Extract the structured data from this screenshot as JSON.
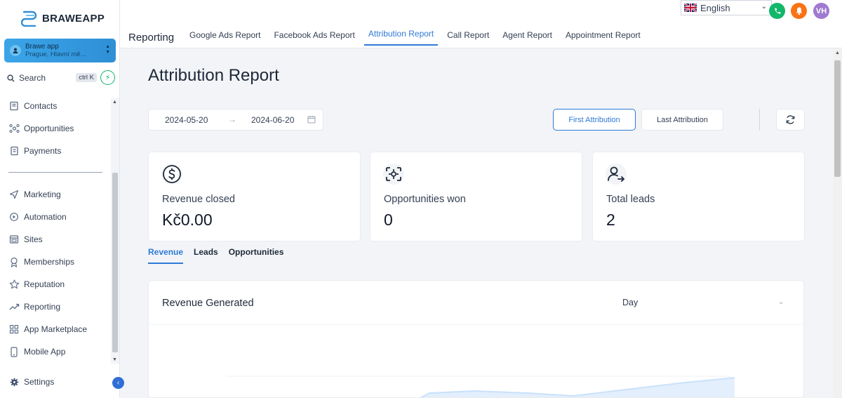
{
  "sidebar": {
    "logo_text": "BRAWEAPP",
    "account": {
      "name": "Brawe app",
      "location": "Prague, Hlavní mě..."
    },
    "search": {
      "label": "Search",
      "shortcut": "ctrl K"
    },
    "items_top": [
      {
        "label": "Contacts",
        "icon": "contacts-icon"
      },
      {
        "label": "Opportunities",
        "icon": "opportunities-icon"
      },
      {
        "label": "Payments",
        "icon": "payments-icon"
      }
    ],
    "items_bottom": [
      {
        "label": "Marketing",
        "icon": "send-icon"
      },
      {
        "label": "Automation",
        "icon": "automation-icon"
      },
      {
        "label": "Sites",
        "icon": "sites-icon"
      },
      {
        "label": "Memberships",
        "icon": "badge-icon"
      },
      {
        "label": "Reputation",
        "icon": "star-icon"
      },
      {
        "label": "Reporting",
        "icon": "trend-icon"
      },
      {
        "label": "App Marketplace",
        "icon": "grid-icon"
      },
      {
        "label": "Mobile App",
        "icon": "phone-icon"
      }
    ],
    "settings_label": "Settings"
  },
  "header": {
    "language": "English",
    "avatar_initials": "VH",
    "section_title": "Reporting",
    "tabs": [
      {
        "label": "Google Ads Report"
      },
      {
        "label": "Facebook Ads Report"
      },
      {
        "label": "Attribution Report"
      },
      {
        "label": "Call Report"
      },
      {
        "label": "Agent Report"
      },
      {
        "label": "Appointment Report"
      }
    ],
    "active_tab": "Attribution Report"
  },
  "main": {
    "title": "Attribution Report",
    "date_from": "2024-05-20",
    "date_to": "2024-06-20",
    "first_attribution_label": "First Attribution",
    "last_attribution_label": "Last Attribution",
    "cards": [
      {
        "label": "Revenue closed",
        "value": "Kč0.00",
        "icon": "dollar-icon"
      },
      {
        "label": "Opportunities won",
        "value": "0",
        "icon": "target-icon"
      },
      {
        "label": "Total leads",
        "value": "2",
        "icon": "user-arrow-icon"
      }
    ],
    "subtabs": [
      {
        "label": "Revenue"
      },
      {
        "label": "Leads"
      },
      {
        "label": "Opportunities"
      }
    ],
    "active_subtab": "Revenue",
    "panel": {
      "title": "Revenue Generated",
      "interval": "Day"
    }
  },
  "colors": {
    "accent": "#2f7ad6",
    "phone_green": "#12b76a",
    "bell_orange": "#f97316",
    "avatar_purple": "#a07ad0"
  }
}
